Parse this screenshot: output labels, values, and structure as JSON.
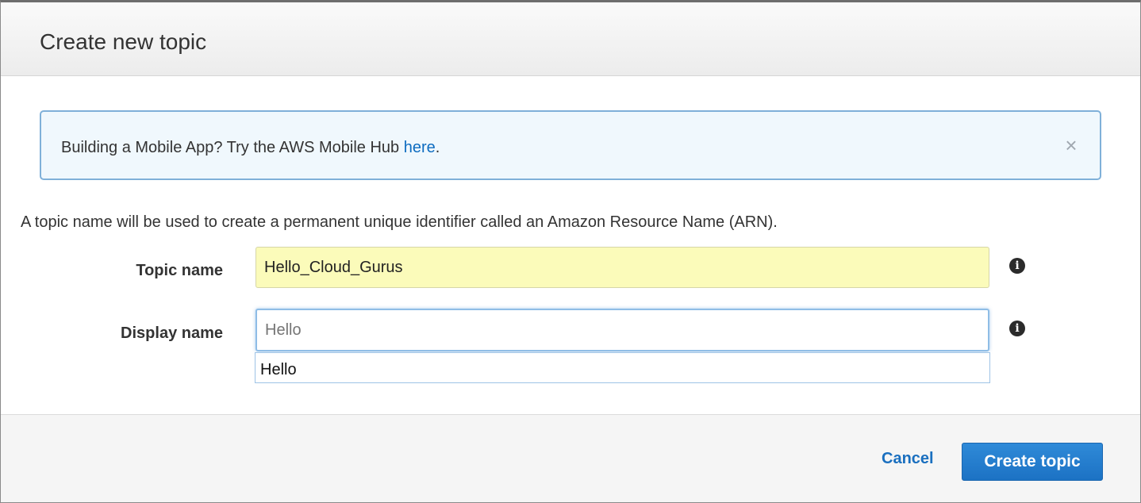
{
  "dialog": {
    "title": "Create new topic"
  },
  "banner": {
    "text_before_link": "Building a Mobile App? Try the AWS Mobile Hub ",
    "link_text": "here",
    "text_after_link": ".",
    "close_glyph": "×",
    "close_icon": "close-icon"
  },
  "form": {
    "description": "A topic name will be used to create a permanent unique identifier called an Amazon Resource Name (ARN).",
    "topic_name": {
      "label": "Topic name",
      "value": "Hello_Cloud_Gurus",
      "info_glyph": "i"
    },
    "display_name": {
      "label": "Display name",
      "value": "",
      "placeholder": "Hello",
      "info_glyph": "i",
      "autocomplete_suggestion": "Hello"
    }
  },
  "footer": {
    "cancel_label": "Cancel",
    "create_label": "Create topic"
  },
  "colors": {
    "accent": "#1c72c4",
    "link": "#0e6cc0",
    "autofill_background": "#fbfbba",
    "banner_background": "#f0f8fd",
    "banner_border": "#7fb0d9"
  }
}
